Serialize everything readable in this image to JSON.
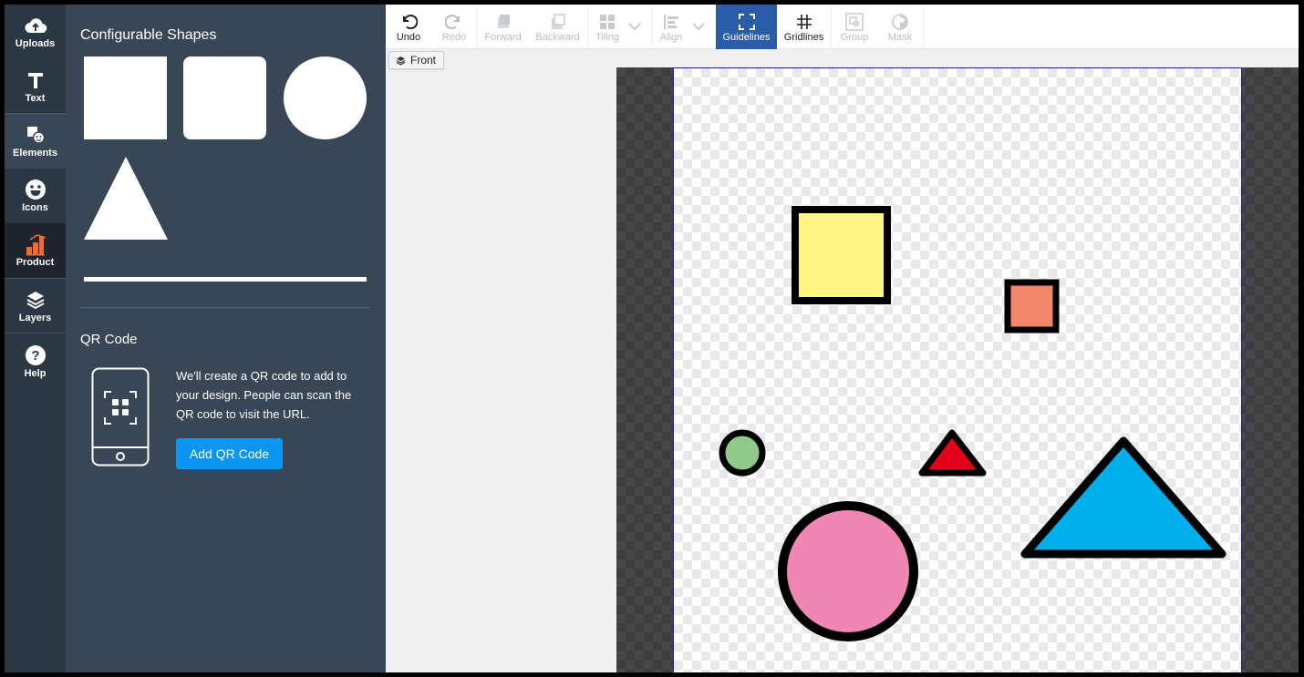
{
  "rail": {
    "items": [
      {
        "label": "Uploads",
        "icon": "cloud-upload-icon"
      },
      {
        "label": "Text",
        "icon": "text-icon"
      },
      {
        "label": "Elements",
        "icon": "elements-icon"
      },
      {
        "label": "Icons",
        "icon": "smiley-icon"
      },
      {
        "label": "Product",
        "icon": "product-icon"
      },
      {
        "label": "Layers",
        "icon": "layers-icon"
      },
      {
        "label": "Help",
        "icon": "help-icon"
      }
    ],
    "active": "Elements",
    "product_color": "#f26b2d"
  },
  "panel": {
    "shapes_title": "Configurable Shapes",
    "shapes": [
      "square",
      "rounded-square",
      "circle",
      "triangle",
      "line"
    ],
    "qr_title": "QR Code",
    "qr_description": "We'll create a QR code to add to your design. People can scan the QR code to visit the URL.",
    "qr_button": "Add QR Code"
  },
  "toolbar": {
    "undo": "Undo",
    "redo": "Redo",
    "forward": "Forward",
    "backward": "Backward",
    "tiling": "Tiling",
    "align": "Align",
    "guidelines": "Guidelines",
    "gridlines": "Gridlines",
    "group": "Group",
    "mask": "Mask",
    "active": "Guidelines",
    "active_color": "#2b5ca8"
  },
  "workspace": {
    "side_label": "Front"
  },
  "canvas_shapes": [
    {
      "type": "square",
      "fill": "#fff685",
      "stroke": "#000000"
    },
    {
      "type": "square",
      "fill": "#f2866a",
      "stroke": "#000000"
    },
    {
      "type": "circle",
      "fill": "#91c98a",
      "stroke": "#000000"
    },
    {
      "type": "triangle",
      "fill": "#e2001a",
      "stroke": "#000000"
    },
    {
      "type": "circle",
      "fill": "#ef86b4",
      "stroke": "#000000"
    },
    {
      "type": "triangle",
      "fill": "#00aeea",
      "stroke": "#000000"
    }
  ]
}
